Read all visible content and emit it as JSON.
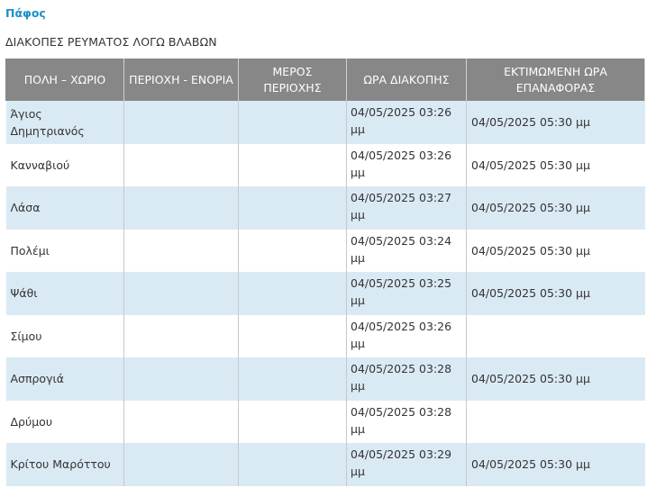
{
  "region": {
    "name": "Πάφος"
  },
  "subtitle": "ΔΙΑΚΟΠΕΣ ΡΕΥΜΑΤΟΣ ΛΟΓΩ ΒΛΑΒΩΝ",
  "table": {
    "headers": [
      "ΠΟΛΗ – ΧΩΡΙΟ",
      "ΠΕΡΙΟΧΗ - ΕΝΟΡΙΑ",
      "ΜΕΡΟΣ ΠΕΡΙΟΧΗΣ",
      "ΩΡΑ ΔΙΑΚΟΠΗΣ",
      "ΕΚΤΙΜΩΜΕΝΗ ΩΡΑ ΕΠΑΝΑΦΟΡΑΣ"
    ],
    "rows": [
      {
        "town": "Άγιος Δημητριανός",
        "area": "",
        "part": "",
        "outage_time": "04/05/2025 03:26 μμ",
        "restore_time": "04/05/2025 05:30 μμ"
      },
      {
        "town": "Κανναβιού",
        "area": "",
        "part": "",
        "outage_time": "04/05/2025 03:26 μμ",
        "restore_time": "04/05/2025 05:30 μμ"
      },
      {
        "town": "Λάσα",
        "area": "",
        "part": "",
        "outage_time": "04/05/2025 03:27 μμ",
        "restore_time": "04/05/2025 05:30 μμ"
      },
      {
        "town": "Πολέμι",
        "area": "",
        "part": "",
        "outage_time": "04/05/2025 03:24 μμ",
        "restore_time": "04/05/2025 05:30 μμ"
      },
      {
        "town": "Ψάθι",
        "area": "",
        "part": "",
        "outage_time": "04/05/2025 03:25 μμ",
        "restore_time": "04/05/2025 05:30 μμ"
      },
      {
        "town": "Σίμου",
        "area": "",
        "part": "",
        "outage_time": "04/05/2025 03:26 μμ",
        "restore_time": ""
      },
      {
        "town": "Ασπρογιά",
        "area": "",
        "part": "",
        "outage_time": "04/05/2025 03:28 μμ",
        "restore_time": "04/05/2025 05:30 μμ"
      },
      {
        "town": "Δρύμου",
        "area": "",
        "part": "",
        "outage_time": "04/05/2025 03:28 μμ",
        "restore_time": ""
      },
      {
        "town": "Κρίτου Μαρόττου",
        "area": "",
        "part": "",
        "outage_time": "04/05/2025 03:29 μμ",
        "restore_time": "04/05/2025 05:30 μμ"
      }
    ]
  }
}
